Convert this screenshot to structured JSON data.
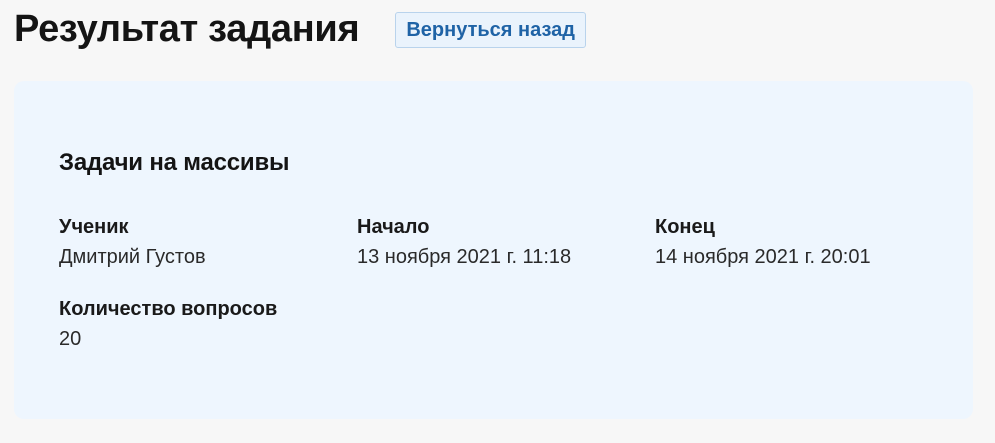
{
  "header": {
    "title": "Результат задания",
    "back_label": "Вернуться назад"
  },
  "card": {
    "title": "Задачи на массивы",
    "fields": [
      {
        "label": "Ученик",
        "value": "Дмитрий Густов"
      },
      {
        "label": "Начало",
        "value": "13 ноября 2021 г. 11:18"
      },
      {
        "label": "Конец",
        "value": "14 ноября 2021 г. 20:01"
      },
      {
        "label": "Количество вопросов",
        "value": "20"
      }
    ]
  }
}
